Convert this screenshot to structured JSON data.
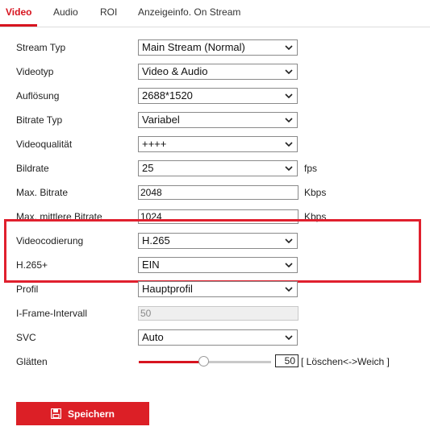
{
  "tabs": [
    {
      "label": "Video",
      "active": true
    },
    {
      "label": "Audio",
      "active": false
    },
    {
      "label": "ROI",
      "active": false
    },
    {
      "label": "Anzeigeinfo. On Stream",
      "active": false
    }
  ],
  "form": {
    "stream_type": {
      "label": "Stream Typ",
      "value": "Main Stream (Normal)"
    },
    "video_type": {
      "label": "Videotyp",
      "value": "Video & Audio"
    },
    "resolution": {
      "label": "Auflösung",
      "value": "2688*1520"
    },
    "bitrate_type": {
      "label": "Bitrate Typ",
      "value": "Variabel"
    },
    "video_quality": {
      "label": "Videoqualität",
      "value": "++++"
    },
    "frame_rate": {
      "label": "Bildrate",
      "value": "25",
      "unit": "fps"
    },
    "max_bitrate": {
      "label": "Max. Bitrate",
      "value": "2048",
      "unit": "Kbps"
    },
    "max_avg_bitrate": {
      "label": "Max. mittlere Bitrate",
      "value": "1024",
      "unit": "Kbps"
    },
    "video_encoding": {
      "label": "Videocodierung",
      "value": "H.265"
    },
    "h265plus": {
      "label": "H.265+",
      "value": "EIN"
    },
    "profile": {
      "label": "Profil",
      "value": "Hauptprofil"
    },
    "iframe_interval": {
      "label": "I-Frame-Intervall",
      "value": "50"
    },
    "svc": {
      "label": "SVC",
      "value": "Auto"
    },
    "smoothing": {
      "label": "Glätten",
      "value": "50",
      "level": 0.5,
      "hint": "[ Löschen<->Weich ]"
    }
  },
  "save_button": {
    "label": "Speichern"
  },
  "colors": {
    "accent": "#d7141f",
    "highlight": "#e0202e"
  }
}
